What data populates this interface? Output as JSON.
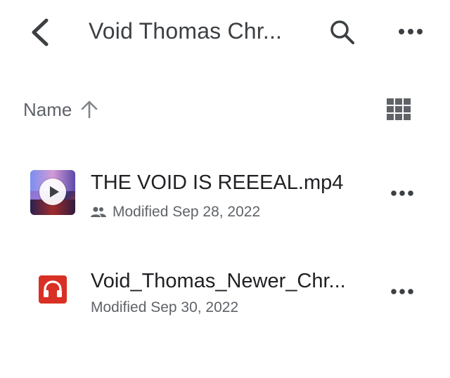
{
  "header": {
    "title": "Void Thomas Chr..."
  },
  "sort": {
    "label": "Name"
  },
  "files": [
    {
      "name": "THE VOID IS REEEAL.mp4",
      "modified": "Modified Sep 28, 2022"
    },
    {
      "name": "Void_Thomas_Newer_Chr...",
      "modified": "Modified Sep 30, 2022"
    }
  ],
  "colors": {
    "text_primary": "#202124",
    "text_secondary": "#5f6368",
    "audio_icon": "#d93025"
  }
}
